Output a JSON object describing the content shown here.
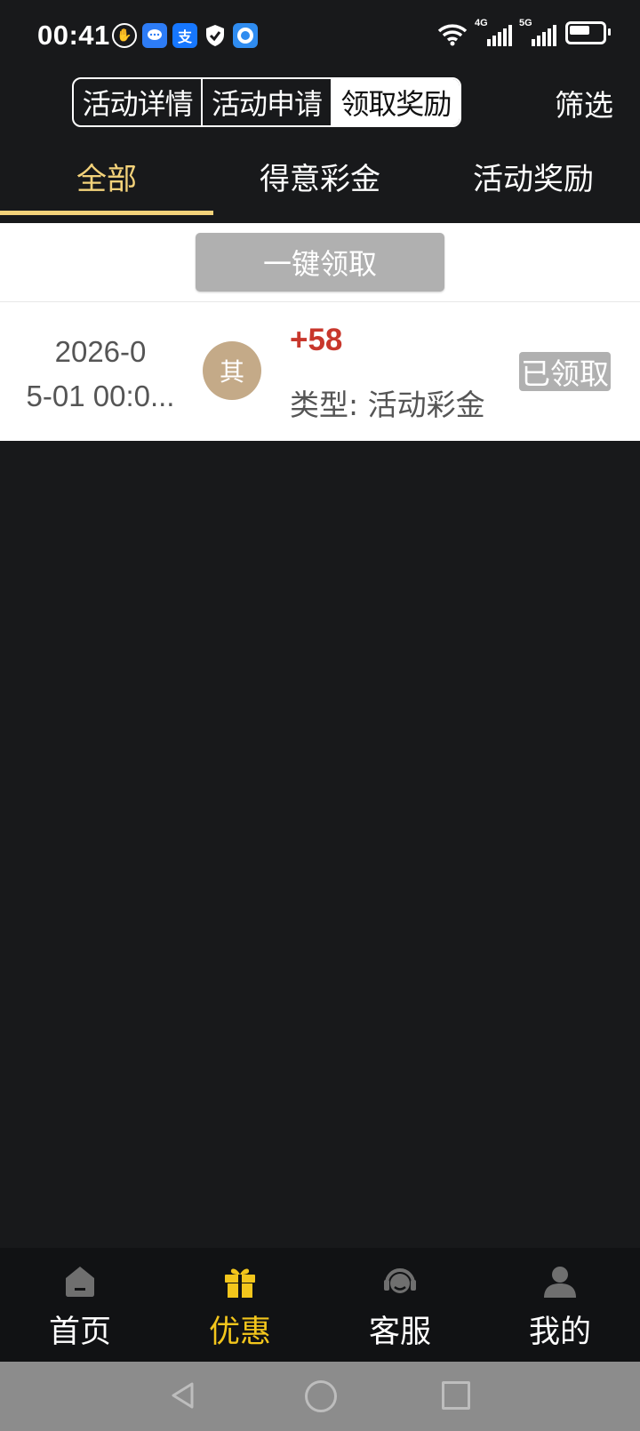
{
  "status_bar": {
    "time": "00:41",
    "left_icons": [
      "hand-stop-icon",
      "message-app-icon",
      "alipay-icon",
      "shield-check-icon",
      "browser-app-icon"
    ],
    "pay_glyph": "支",
    "signal_labels": [
      "4G",
      "5G"
    ]
  },
  "header": {
    "segments": [
      {
        "label": "活动详情",
        "active": false
      },
      {
        "label": "活动申请",
        "active": false
      },
      {
        "label": "领取奖励",
        "active": true
      }
    ],
    "filter_label": "筛选"
  },
  "category_tabs": [
    {
      "label": "全部",
      "active": true
    },
    {
      "label": "得意彩金",
      "active": false
    },
    {
      "label": "活动奖励",
      "active": false
    }
  ],
  "claim_all_label": "一键领取",
  "records": [
    {
      "date_line1": "2026-0",
      "date_line2": "5-01 00:0...",
      "avatar_text": "其",
      "amount": "+58",
      "type": "类型: 活动彩金",
      "status": "已领取"
    }
  ],
  "bottom_nav": [
    {
      "label": "首页",
      "icon": "home-icon",
      "active": false
    },
    {
      "label": "优惠",
      "icon": "gift-icon",
      "active": true
    },
    {
      "label": "客服",
      "icon": "headset-icon",
      "active": false
    },
    {
      "label": "我的",
      "icon": "user-icon",
      "active": false
    }
  ],
  "colors": {
    "background": "#18191b",
    "accent_gold": "#f3d27a",
    "nav_active": "#f3c61c",
    "amount_red": "#c8372c",
    "disabled_gray": "#b0b0b0"
  }
}
